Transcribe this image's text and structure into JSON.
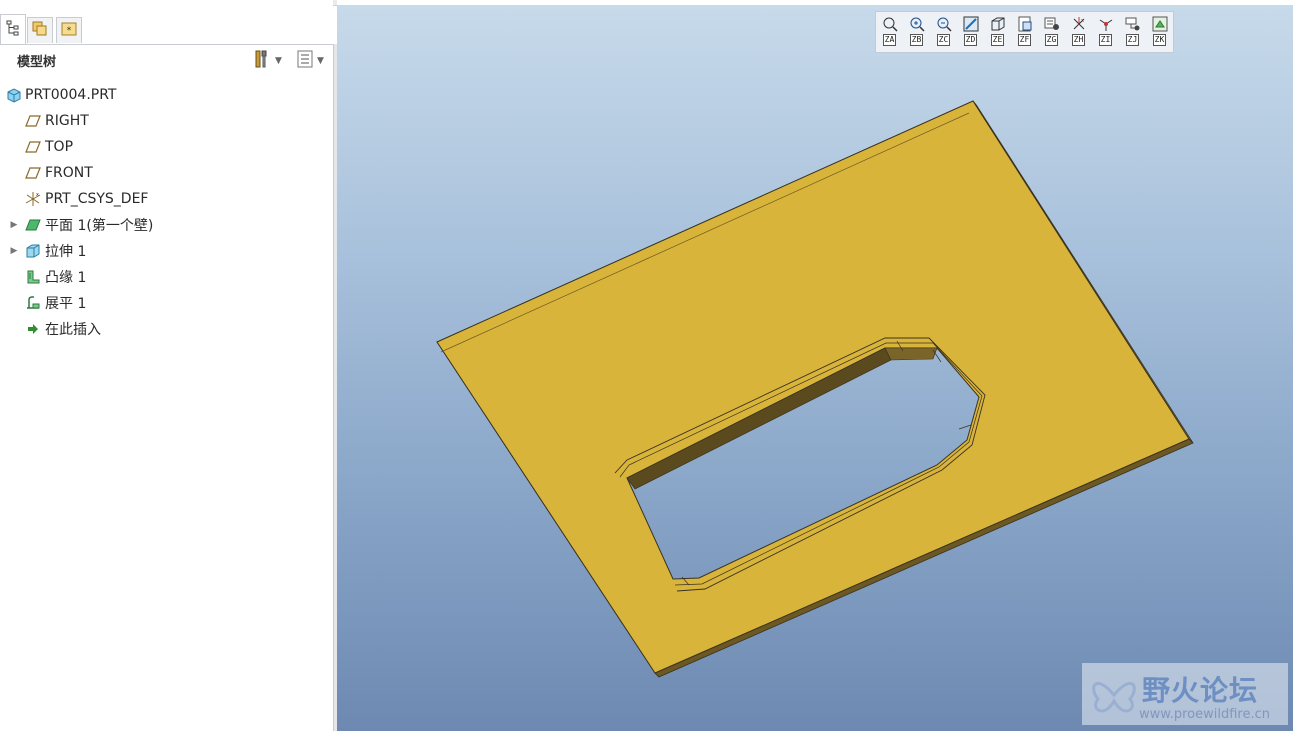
{
  "left_panel": {
    "tabs": [
      {
        "name": "model-tree-tab",
        "icon": "model-tree-icon",
        "active": true
      },
      {
        "name": "layers-tab",
        "icon": "layers-icon",
        "active": false
      },
      {
        "name": "favorites-tab",
        "icon": "favorites-icon",
        "active": false
      }
    ],
    "title": "模型树",
    "tree_items": [
      {
        "label": "PRT0004.PRT",
        "icon": "part-icon",
        "expandable": false
      },
      {
        "label": "RIGHT",
        "icon": "datum-plane-icon",
        "expandable": false
      },
      {
        "label": "TOP",
        "icon": "datum-plane-icon",
        "expandable": false
      },
      {
        "label": "FRONT",
        "icon": "datum-plane-icon",
        "expandable": false
      },
      {
        "label": "PRT_CSYS_DEF",
        "icon": "coordinate-system-icon",
        "expandable": false
      },
      {
        "label": "平面 1(第一个壁)",
        "icon": "planar-wall-icon",
        "expandable": true
      },
      {
        "label": "拉伸 1",
        "icon": "extrude-icon",
        "expandable": true
      },
      {
        "label": "凸缘 1",
        "icon": "flange-icon",
        "expandable": false
      },
      {
        "label": "展平 1",
        "icon": "unbend-icon",
        "expandable": false
      },
      {
        "label": "在此插入",
        "icon": "insert-here-arrow-icon",
        "expandable": false
      }
    ]
  },
  "view_toolbar": [
    {
      "key": "ZA",
      "icon": "refit-icon"
    },
    {
      "key": "ZB",
      "icon": "zoom-in-icon"
    },
    {
      "key": "ZC",
      "icon": "zoom-out-icon"
    },
    {
      "key": "ZD",
      "icon": "repaint-icon"
    },
    {
      "key": "ZE",
      "icon": "display-style-icon"
    },
    {
      "key": "ZF",
      "icon": "saved-views-icon"
    },
    {
      "key": "ZG",
      "icon": "view-manager-icon"
    },
    {
      "key": "ZH",
      "icon": "datum-display-icon"
    },
    {
      "key": "ZI",
      "icon": "spin-center-icon"
    },
    {
      "key": "ZJ",
      "icon": "annotation-display-icon"
    },
    {
      "key": "ZK",
      "icon": "appearance-icon"
    }
  ],
  "colors": {
    "part_face": "#d9b43a",
    "part_edge": "#3a3220",
    "viewport_top": "#c7daea",
    "viewport_bottom": "#6d89b2"
  },
  "watermark": {
    "title": "野火论坛",
    "url": "www.proewildfire.cn"
  }
}
